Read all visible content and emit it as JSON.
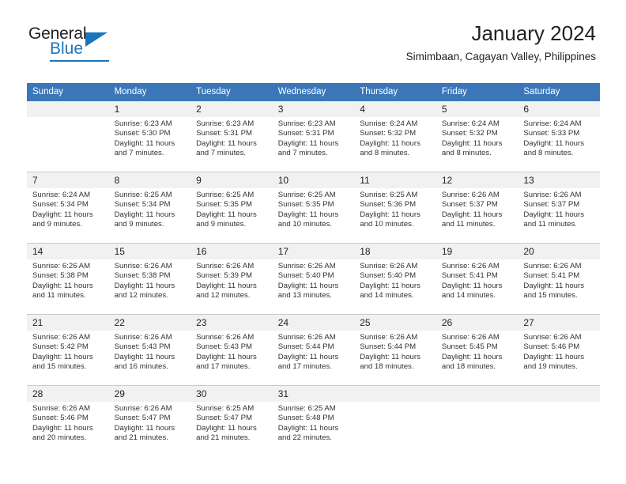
{
  "brand": {
    "name_top": "General",
    "name_bottom": "Blue",
    "triangle_icon": "triangle-icon",
    "accent_color": "#1b75bb"
  },
  "header": {
    "title": "January 2024",
    "subtitle": "Simimbaan, Cagayan Valley, Philippines"
  },
  "theme": {
    "header_row_color": "#3b77b8",
    "daynum_row_color": "#f1f1f1",
    "body_color": "#ffffff",
    "rule_color": "#c9c9c9"
  },
  "calendar": {
    "weekday_headers": [
      "Sunday",
      "Monday",
      "Tuesday",
      "Wednesday",
      "Thursday",
      "Friday",
      "Saturday"
    ],
    "weeks": [
      {
        "days": [
          {
            "number": "",
            "sunrise": "",
            "sunset": "",
            "daylight_1": "",
            "daylight_2": ""
          },
          {
            "number": "1",
            "sunrise": "Sunrise: 6:23 AM",
            "sunset": "Sunset: 5:30 PM",
            "daylight_1": "Daylight: 11 hours",
            "daylight_2": "and 7 minutes."
          },
          {
            "number": "2",
            "sunrise": "Sunrise: 6:23 AM",
            "sunset": "Sunset: 5:31 PM",
            "daylight_1": "Daylight: 11 hours",
            "daylight_2": "and 7 minutes."
          },
          {
            "number": "3",
            "sunrise": "Sunrise: 6:23 AM",
            "sunset": "Sunset: 5:31 PM",
            "daylight_1": "Daylight: 11 hours",
            "daylight_2": "and 7 minutes."
          },
          {
            "number": "4",
            "sunrise": "Sunrise: 6:24 AM",
            "sunset": "Sunset: 5:32 PM",
            "daylight_1": "Daylight: 11 hours",
            "daylight_2": "and 8 minutes."
          },
          {
            "number": "5",
            "sunrise": "Sunrise: 6:24 AM",
            "sunset": "Sunset: 5:32 PM",
            "daylight_1": "Daylight: 11 hours",
            "daylight_2": "and 8 minutes."
          },
          {
            "number": "6",
            "sunrise": "Sunrise: 6:24 AM",
            "sunset": "Sunset: 5:33 PM",
            "daylight_1": "Daylight: 11 hours",
            "daylight_2": "and 8 minutes."
          }
        ]
      },
      {
        "days": [
          {
            "number": "7",
            "sunrise": "Sunrise: 6:24 AM",
            "sunset": "Sunset: 5:34 PM",
            "daylight_1": "Daylight: 11 hours",
            "daylight_2": "and 9 minutes."
          },
          {
            "number": "8",
            "sunrise": "Sunrise: 6:25 AM",
            "sunset": "Sunset: 5:34 PM",
            "daylight_1": "Daylight: 11 hours",
            "daylight_2": "and 9 minutes."
          },
          {
            "number": "9",
            "sunrise": "Sunrise: 6:25 AM",
            "sunset": "Sunset: 5:35 PM",
            "daylight_1": "Daylight: 11 hours",
            "daylight_2": "and 9 minutes."
          },
          {
            "number": "10",
            "sunrise": "Sunrise: 6:25 AM",
            "sunset": "Sunset: 5:35 PM",
            "daylight_1": "Daylight: 11 hours",
            "daylight_2": "and 10 minutes."
          },
          {
            "number": "11",
            "sunrise": "Sunrise: 6:25 AM",
            "sunset": "Sunset: 5:36 PM",
            "daylight_1": "Daylight: 11 hours",
            "daylight_2": "and 10 minutes."
          },
          {
            "number": "12",
            "sunrise": "Sunrise: 6:26 AM",
            "sunset": "Sunset: 5:37 PM",
            "daylight_1": "Daylight: 11 hours",
            "daylight_2": "and 11 minutes."
          },
          {
            "number": "13",
            "sunrise": "Sunrise: 6:26 AM",
            "sunset": "Sunset: 5:37 PM",
            "daylight_1": "Daylight: 11 hours",
            "daylight_2": "and 11 minutes."
          }
        ]
      },
      {
        "days": [
          {
            "number": "14",
            "sunrise": "Sunrise: 6:26 AM",
            "sunset": "Sunset: 5:38 PM",
            "daylight_1": "Daylight: 11 hours",
            "daylight_2": "and 11 minutes."
          },
          {
            "number": "15",
            "sunrise": "Sunrise: 6:26 AM",
            "sunset": "Sunset: 5:38 PM",
            "daylight_1": "Daylight: 11 hours",
            "daylight_2": "and 12 minutes."
          },
          {
            "number": "16",
            "sunrise": "Sunrise: 6:26 AM",
            "sunset": "Sunset: 5:39 PM",
            "daylight_1": "Daylight: 11 hours",
            "daylight_2": "and 12 minutes."
          },
          {
            "number": "17",
            "sunrise": "Sunrise: 6:26 AM",
            "sunset": "Sunset: 5:40 PM",
            "daylight_1": "Daylight: 11 hours",
            "daylight_2": "and 13 minutes."
          },
          {
            "number": "18",
            "sunrise": "Sunrise: 6:26 AM",
            "sunset": "Sunset: 5:40 PM",
            "daylight_1": "Daylight: 11 hours",
            "daylight_2": "and 14 minutes."
          },
          {
            "number": "19",
            "sunrise": "Sunrise: 6:26 AM",
            "sunset": "Sunset: 5:41 PM",
            "daylight_1": "Daylight: 11 hours",
            "daylight_2": "and 14 minutes."
          },
          {
            "number": "20",
            "sunrise": "Sunrise: 6:26 AM",
            "sunset": "Sunset: 5:41 PM",
            "daylight_1": "Daylight: 11 hours",
            "daylight_2": "and 15 minutes."
          }
        ]
      },
      {
        "days": [
          {
            "number": "21",
            "sunrise": "Sunrise: 6:26 AM",
            "sunset": "Sunset: 5:42 PM",
            "daylight_1": "Daylight: 11 hours",
            "daylight_2": "and 15 minutes."
          },
          {
            "number": "22",
            "sunrise": "Sunrise: 6:26 AM",
            "sunset": "Sunset: 5:43 PM",
            "daylight_1": "Daylight: 11 hours",
            "daylight_2": "and 16 minutes."
          },
          {
            "number": "23",
            "sunrise": "Sunrise: 6:26 AM",
            "sunset": "Sunset: 5:43 PM",
            "daylight_1": "Daylight: 11 hours",
            "daylight_2": "and 17 minutes."
          },
          {
            "number": "24",
            "sunrise": "Sunrise: 6:26 AM",
            "sunset": "Sunset: 5:44 PM",
            "daylight_1": "Daylight: 11 hours",
            "daylight_2": "and 17 minutes."
          },
          {
            "number": "25",
            "sunrise": "Sunrise: 6:26 AM",
            "sunset": "Sunset: 5:44 PM",
            "daylight_1": "Daylight: 11 hours",
            "daylight_2": "and 18 minutes."
          },
          {
            "number": "26",
            "sunrise": "Sunrise: 6:26 AM",
            "sunset": "Sunset: 5:45 PM",
            "daylight_1": "Daylight: 11 hours",
            "daylight_2": "and 18 minutes."
          },
          {
            "number": "27",
            "sunrise": "Sunrise: 6:26 AM",
            "sunset": "Sunset: 5:46 PM",
            "daylight_1": "Daylight: 11 hours",
            "daylight_2": "and 19 minutes."
          }
        ]
      },
      {
        "days": [
          {
            "number": "28",
            "sunrise": "Sunrise: 6:26 AM",
            "sunset": "Sunset: 5:46 PM",
            "daylight_1": "Daylight: 11 hours",
            "daylight_2": "and 20 minutes."
          },
          {
            "number": "29",
            "sunrise": "Sunrise: 6:26 AM",
            "sunset": "Sunset: 5:47 PM",
            "daylight_1": "Daylight: 11 hours",
            "daylight_2": "and 21 minutes."
          },
          {
            "number": "30",
            "sunrise": "Sunrise: 6:25 AM",
            "sunset": "Sunset: 5:47 PM",
            "daylight_1": "Daylight: 11 hours",
            "daylight_2": "and 21 minutes."
          },
          {
            "number": "31",
            "sunrise": "Sunrise: 6:25 AM",
            "sunset": "Sunset: 5:48 PM",
            "daylight_1": "Daylight: 11 hours",
            "daylight_2": "and 22 minutes."
          },
          {
            "number": "",
            "sunrise": "",
            "sunset": "",
            "daylight_1": "",
            "daylight_2": ""
          },
          {
            "number": "",
            "sunrise": "",
            "sunset": "",
            "daylight_1": "",
            "daylight_2": ""
          },
          {
            "number": "",
            "sunrise": "",
            "sunset": "",
            "daylight_1": "",
            "daylight_2": ""
          }
        ]
      }
    ]
  }
}
